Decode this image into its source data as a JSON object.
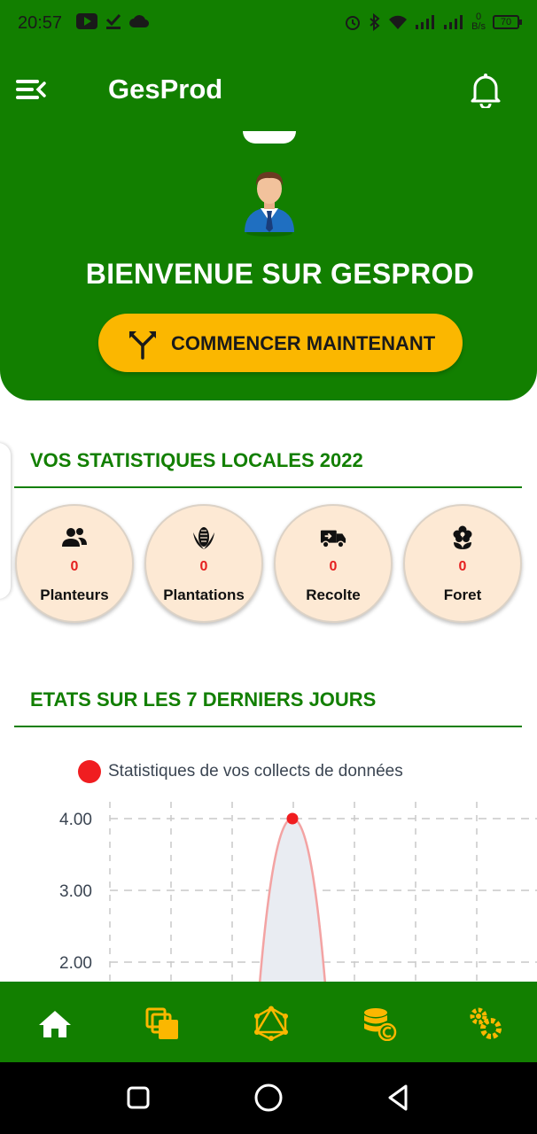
{
  "status_bar": {
    "time": "20:57",
    "speed_value": "0",
    "speed_unit": "B/s",
    "battery": "70"
  },
  "app_bar": {
    "title": "GesProd"
  },
  "hero": {
    "welcome": "BIENVENUE SUR GESPROD",
    "start_button": "COMMENCER MAINTENANT"
  },
  "stats_section": {
    "title": "VOS STATISTIQUES LOCALES 2022",
    "items": [
      {
        "label": "Planteurs",
        "value": "0",
        "icon": "people-icon"
      },
      {
        "label": "Plantations",
        "value": "0",
        "icon": "corn-icon"
      },
      {
        "label": "Recolte",
        "value": "0",
        "icon": "truck-icon"
      },
      {
        "label": "Foret",
        "value": "0",
        "icon": "flower-icon"
      }
    ]
  },
  "chart_section": {
    "title": "ETATS SUR LES 7 DERNIERS JOURS"
  },
  "chart_data": {
    "type": "line",
    "series": [
      {
        "name": "Statistiques de vos collects de données",
        "values": [
          0,
          0,
          0,
          4,
          0,
          0,
          0
        ],
        "color": "#f01d20"
      }
    ],
    "y_ticks": [
      "4.00",
      "3.00",
      "2.00"
    ],
    "ylim": [
      0,
      4.3
    ],
    "grid": true,
    "legend_placement": "top"
  },
  "colors": {
    "primary": "#127f00",
    "accent": "#fbb700",
    "stat_bg": "#fde9d4",
    "value": "#e52020"
  },
  "bottom_nav": [
    "home-icon",
    "collections-icon",
    "network-icon",
    "database-sync-icon",
    "settings-icon"
  ],
  "system_nav": [
    "recent-apps-icon",
    "home-circle-icon",
    "back-icon"
  ]
}
